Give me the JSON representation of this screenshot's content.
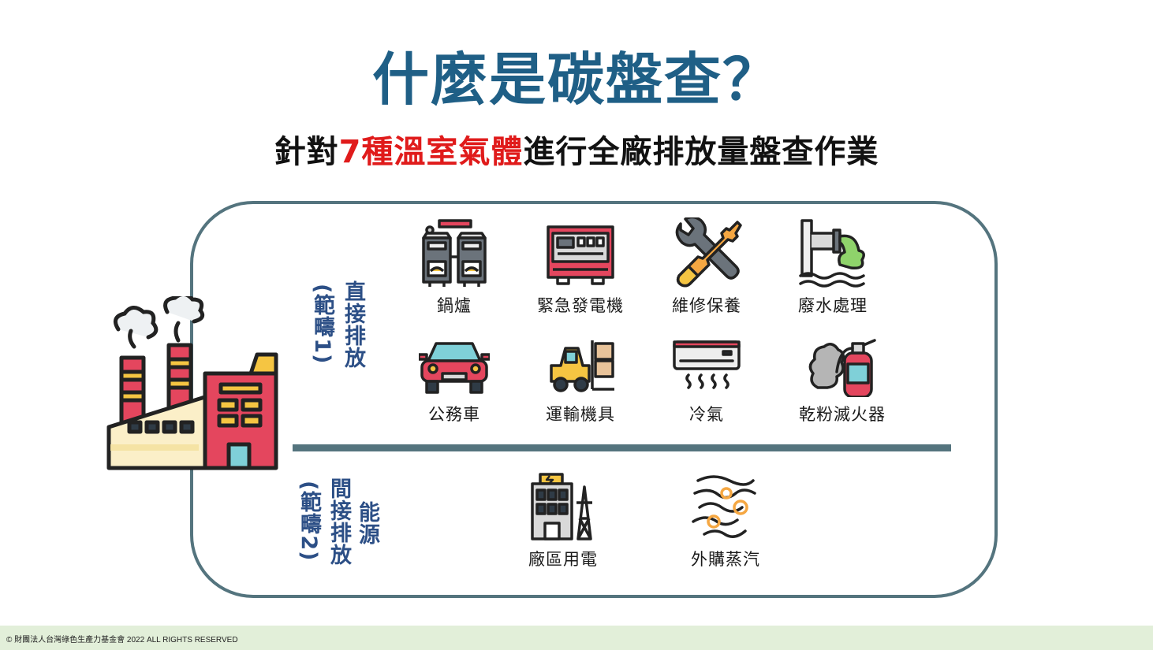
{
  "title": "什麼是碳盤查？",
  "subtitle": {
    "prefix": "針對",
    "highlight": "7種溫室氣體",
    "suffix": "進行全廠排放量盤查作業"
  },
  "colors": {
    "title": "#1f5f86",
    "highlight": "#e01b1b",
    "frame": "#54747e",
    "scope_text": "#2c4f86",
    "footer_bg": "#e2efd9"
  },
  "scope1": {
    "label": "直接排放",
    "scope": "(範疇1)",
    "items": [
      {
        "label": "鍋爐",
        "icon": "boiler-icon"
      },
      {
        "label": "緊急發電機",
        "icon": "generator-icon"
      },
      {
        "label": "維修保養",
        "icon": "wrench-screwdriver-icon"
      },
      {
        "label": "廢水處理",
        "icon": "wastewater-icon"
      },
      {
        "label": "公務車",
        "icon": "car-icon"
      },
      {
        "label": "運輸機具",
        "icon": "forklift-icon"
      },
      {
        "label": "冷氣",
        "icon": "air-conditioner-icon"
      },
      {
        "label": "乾粉滅火器",
        "icon": "fire-extinguisher-icon"
      }
    ]
  },
  "scope2": {
    "label_line1": "間接排放",
    "label_line2": "能源",
    "scope": "(範疇2)",
    "items": [
      {
        "label": "廠區用電",
        "icon": "power-building-icon"
      },
      {
        "label": "外購蒸汽",
        "icon": "steam-icon"
      }
    ]
  },
  "factory_icon": "factory-icon",
  "footer": "© 財團法人台灣綠色生產力基金會 2022 ALL RIGHTS RESERVED"
}
